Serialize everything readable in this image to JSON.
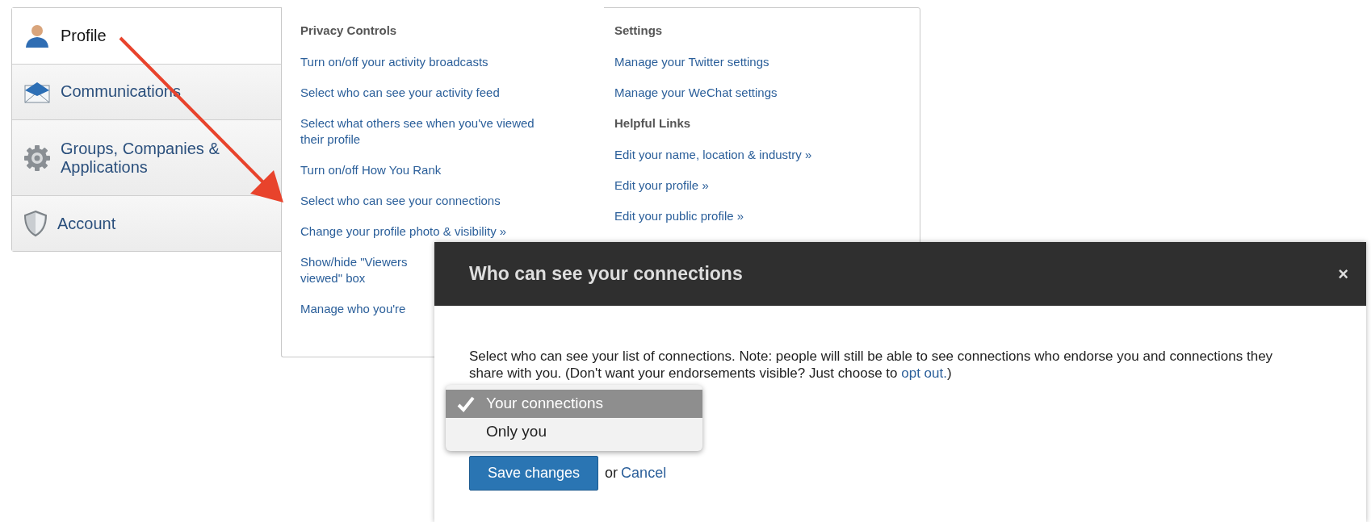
{
  "nav": [
    {
      "label": "Profile",
      "selected": true
    },
    {
      "label": "Communications",
      "selected": false
    },
    {
      "label": "Groups, Companies & Applications",
      "selected": false
    },
    {
      "label": "Account",
      "selected": false
    }
  ],
  "columns": [
    {
      "sections": [
        {
          "heading": "Privacy Controls",
          "links": [
            {
              "lines": [
                "Turn on/off your activity broadcasts"
              ]
            },
            {
              "lines": [
                "Select who can see your activity feed"
              ]
            },
            {
              "lines": [
                "Select what others see when you've viewed",
                "their profile"
              ]
            },
            {
              "lines": [
                "Turn on/off How You Rank"
              ]
            },
            {
              "lines": [
                "Select who can see your connections"
              ]
            },
            {
              "lines": [
                "Change your profile photo & visibility »"
              ]
            },
            {
              "lines": [
                "Show/hide \"Viewers",
                "viewed\" box"
              ]
            },
            {
              "lines": [
                "Manage who you're"
              ]
            }
          ]
        }
      ]
    },
    {
      "sections": [
        {
          "heading": "Settings",
          "links": [
            {
              "lines": [
                "Manage your Twitter settings"
              ]
            },
            {
              "lines": [
                "Manage your WeChat settings"
              ]
            }
          ]
        },
        {
          "heading": "Helpful Links",
          "links": [
            {
              "lines": [
                "Edit your name, location & industry »"
              ]
            },
            {
              "lines": [
                "Edit your profile »"
              ]
            },
            {
              "lines": [
                "Edit your public profile »"
              ]
            }
          ]
        }
      ]
    }
  ],
  "dialog": {
    "title": "Who can see your connections",
    "close": "×",
    "description": {
      "text": "Select who can see your list of connections. Note: people will still be able to see connections who endorse you and connections they share with you. (Don't want your endorsements visible? Just choose to ",
      "link": "opt out.",
      "after": ")"
    },
    "options": [
      {
        "label": "Your connections",
        "selected": true
      },
      {
        "label": "Only you",
        "selected": false
      }
    ],
    "save": "Save changes",
    "or": "or",
    "cancel": "Cancel"
  }
}
